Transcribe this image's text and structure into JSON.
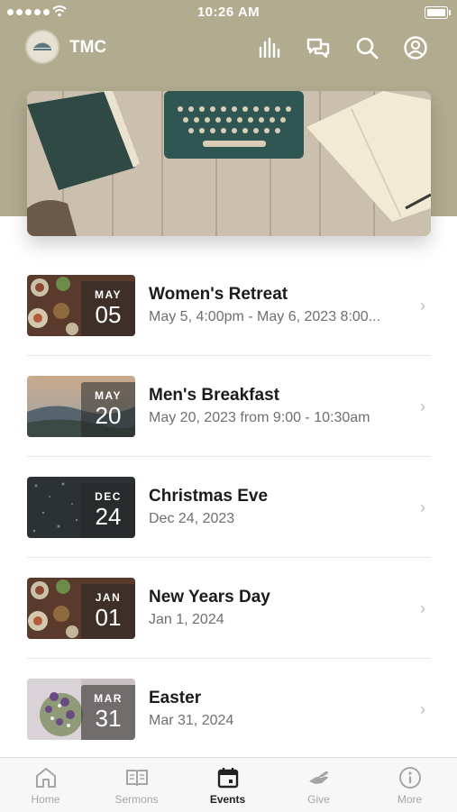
{
  "status_bar": {
    "time": "10:26 AM"
  },
  "app_bar": {
    "title": "TMC",
    "icons": [
      "audio-bars-icon",
      "chat-bubbles-icon",
      "search-icon",
      "profile-icon"
    ]
  },
  "colors": {
    "header": "#b1ab8f",
    "active_tab": "#222222",
    "inactive_tab": "#a5a5a5"
  },
  "events": [
    {
      "title": "Women's Retreat",
      "subtitle": "May 5, 4:00pm - May 6, 2023 8:00...",
      "month": "MAY",
      "day": "05"
    },
    {
      "title": "Men's Breakfast",
      "subtitle": "May 20, 2023 from 9:00 - 10:30am",
      "month": "MAY",
      "day": "20"
    },
    {
      "title": "Christmas Eve",
      "subtitle": "Dec 24, 2023",
      "month": "DEC",
      "day": "24"
    },
    {
      "title": "New Years Day",
      "subtitle": "Jan 1, 2024",
      "month": "JAN",
      "day": "01"
    },
    {
      "title": "Easter",
      "subtitle": "Mar 31, 2024",
      "month": "MAR",
      "day": "31"
    }
  ],
  "tabs": [
    {
      "label": "Home",
      "icon": "home-icon",
      "active": false
    },
    {
      "label": "Sermons",
      "icon": "book-icon",
      "active": false
    },
    {
      "label": "Events",
      "icon": "calendar-icon",
      "active": true
    },
    {
      "label": "Give",
      "icon": "hand-icon",
      "active": false
    },
    {
      "label": "More",
      "icon": "info-icon",
      "active": false
    }
  ]
}
